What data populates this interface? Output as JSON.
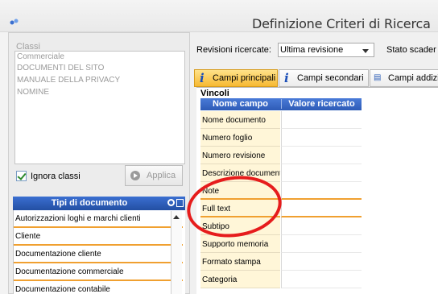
{
  "window": {
    "title": "Definizione Criteri di Ricerca"
  },
  "classi": {
    "header": "Classi",
    "items": [
      "Commerciale",
      "DOCUMENTI DEL SITO",
      "MANUALE DELLA PRIVACY",
      "NOMINE"
    ],
    "ignore_label": "Ignora classi",
    "ignore_checked": true,
    "apply_label": "Applica"
  },
  "tipi_documento": {
    "title": "Tipi di documento",
    "items": [
      "Autorizzazioni loghi e marchi clienti",
      "Cliente",
      "Documentazione cliente",
      "Documentazione commerciale",
      "Documentazione contabile"
    ]
  },
  "search": {
    "revisioni_label": "Revisioni ricercate:",
    "revisioni_value": "Ultima revisione",
    "stato_label": "Stato scader"
  },
  "tabs": [
    {
      "label": "Campi principali",
      "active": true
    },
    {
      "label": "Campi secondari",
      "active": false
    },
    {
      "label": "Campi addizio",
      "active": false
    }
  ],
  "vincoli": {
    "label": "Vincoli",
    "columns": [
      "Nome campo",
      "Valore ricercato"
    ],
    "rows": [
      {
        "name": "Nome documento",
        "value": ""
      },
      {
        "name": "Numero foglio",
        "value": ""
      },
      {
        "name": "Numero revisione",
        "value": ""
      },
      {
        "name": "Descrizione documento",
        "value": ""
      },
      {
        "name": "Note",
        "value": ""
      },
      {
        "name": "Full text",
        "value": ""
      },
      {
        "name": "Subtipo",
        "value": ""
      },
      {
        "name": "Supporto memoria",
        "value": ""
      },
      {
        "name": "Formato stampa",
        "value": ""
      },
      {
        "name": "Categoria",
        "value": ""
      }
    ]
  },
  "colors": {
    "header_blue": "#2d5bb6",
    "active_tab": "#f6b933",
    "row_separator": "#f0a030",
    "annotation": "#e61c1c"
  }
}
